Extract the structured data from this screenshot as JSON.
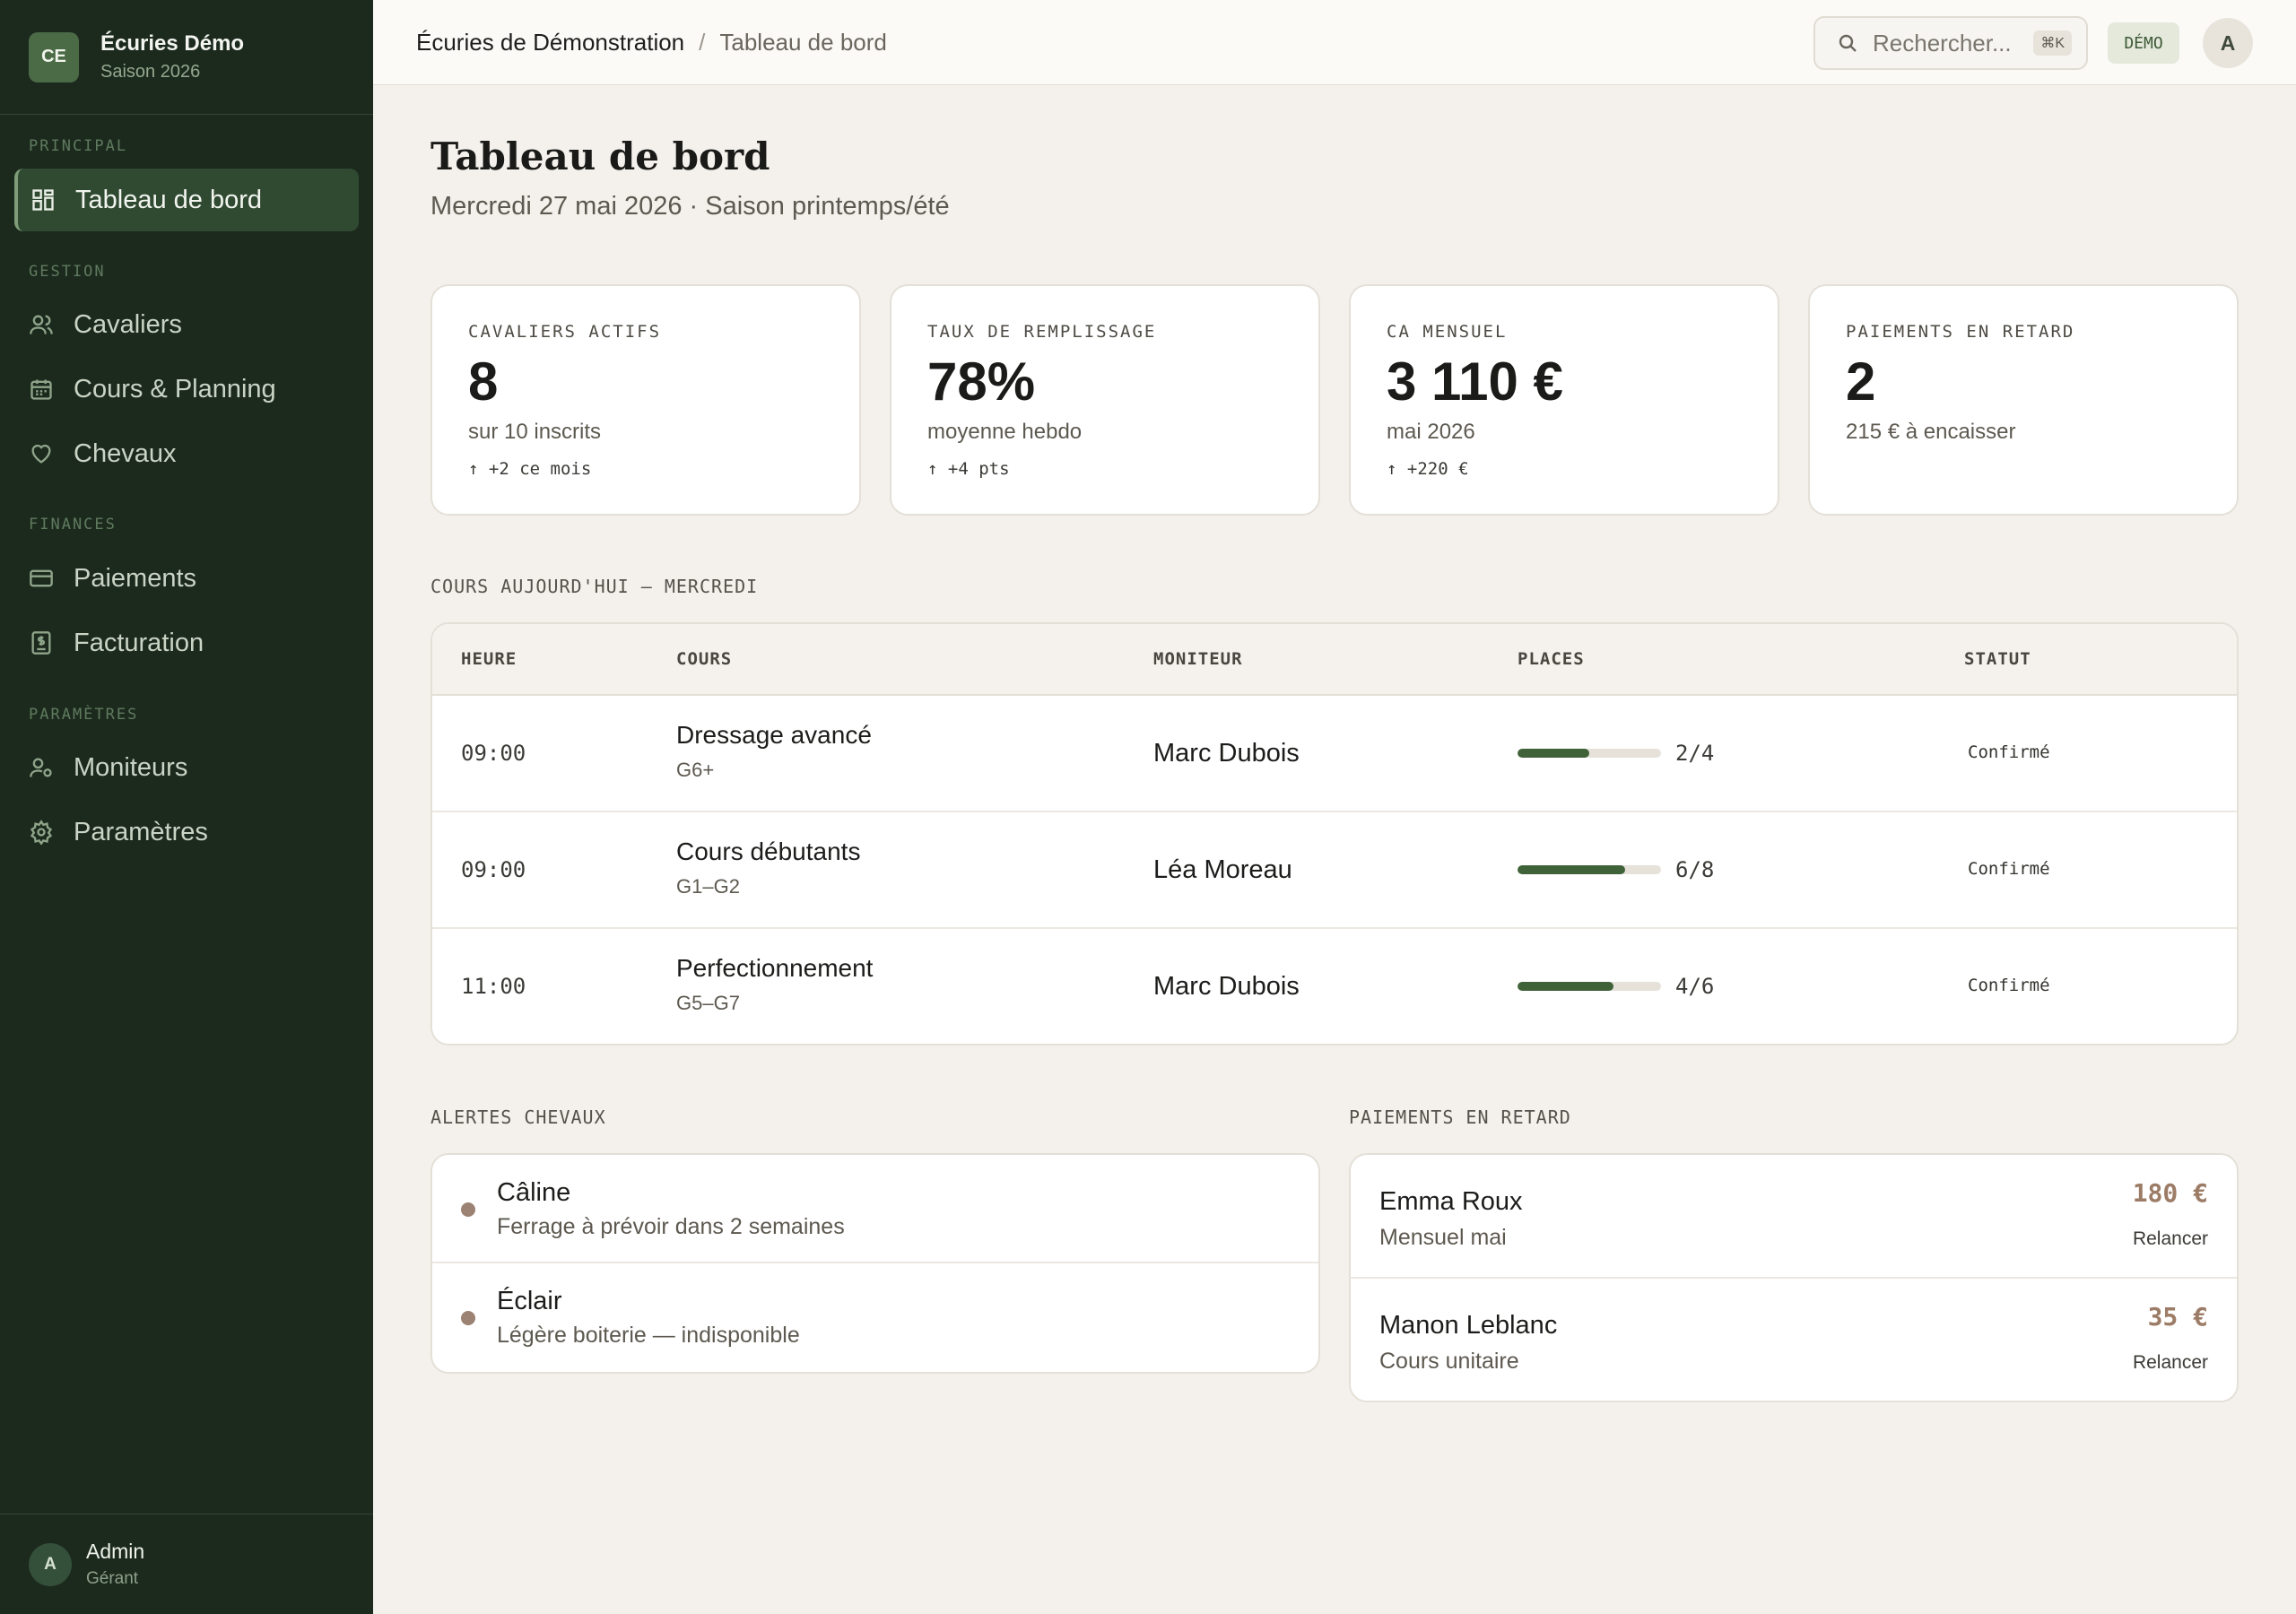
{
  "sidebar": {
    "brand": {
      "initials": "CE",
      "name": "Écuries Démo",
      "subtitle": "Saison 2026"
    },
    "sections": {
      "principal": "PRINCIPAL",
      "gestion": "GESTION",
      "finances": "FINANCES",
      "parametres": "PARAMÈTRES"
    },
    "items": {
      "dashboard": "Tableau de bord",
      "riders": "Cavaliers",
      "lessons": "Cours & Planning",
      "horses": "Chevaux",
      "payments": "Paiements",
      "billing": "Facturation",
      "instructors": "Moniteurs",
      "settings": "Paramètres"
    },
    "user": {
      "initial": "A",
      "name": "Admin",
      "role": "Gérant"
    }
  },
  "topbar": {
    "breadcrumb_root": "Écuries de Démonstration",
    "breadcrumb_sep": "/",
    "breadcrumb_current": "Tableau de bord",
    "search_placeholder": "Rechercher...",
    "search_shortcut": "⌘K",
    "badge": "DÉMO",
    "avatar_initial": "A"
  },
  "page": {
    "title": "Tableau de bord",
    "subtitle": "Mercredi 27 mai 2026 · Saison printemps/été"
  },
  "kpis": [
    {
      "label": "CAVALIERS ACTIFS",
      "value": "8",
      "caption": "sur 10 inscrits",
      "trend": "↑ +2 ce mois"
    },
    {
      "label": "TAUX DE REMPLISSAGE",
      "value": "78%",
      "caption": "moyenne hebdo",
      "trend": "↑ +4 pts"
    },
    {
      "label": "CA MENSUEL",
      "value": "3 110 €",
      "caption": "mai 2026",
      "trend": "↑ +220 €"
    },
    {
      "label": "PAIEMENTS EN RETARD",
      "value": "2",
      "caption": "215 € à encaisser",
      "trend": ""
    }
  ],
  "lessons": {
    "section_title": "COURS AUJOURD'HUI — MERCREDI",
    "headers": {
      "time": "HEURE",
      "course": "COURS",
      "instructor": "MONITEUR",
      "places": "PLACES",
      "status": "STATUT"
    },
    "rows": [
      {
        "time": "09:00",
        "course": "Dressage avancé",
        "level": "G6+",
        "instructor": "Marc Dubois",
        "places": "2/4",
        "fill": 0.5,
        "status": "Confirmé"
      },
      {
        "time": "09:00",
        "course": "Cours débutants",
        "level": "G1–G2",
        "instructor": "Léa Moreau",
        "places": "6/8",
        "fill": 0.75,
        "status": "Confirmé"
      },
      {
        "time": "11:00",
        "course": "Perfectionnement",
        "level": "G5–G7",
        "instructor": "Marc Dubois",
        "places": "4/6",
        "fill": 0.667,
        "status": "Confirmé"
      }
    ]
  },
  "horse_alerts": {
    "section_title": "ALERTES CHEVAUX",
    "items": [
      {
        "name": "Câline",
        "description": "Ferrage à prévoir dans 2 semaines"
      },
      {
        "name": "Éclair",
        "description": "Légère boiterie — indisponible"
      }
    ]
  },
  "late_payments": {
    "section_title": "PAIEMENTS EN RETARD",
    "items": [
      {
        "name": "Emma Roux",
        "description": "Mensuel mai",
        "amount": "180 €",
        "action": "Relancer"
      },
      {
        "name": "Manon Leblanc",
        "description": "Cours unitaire",
        "amount": "35 €",
        "action": "Relancer"
      }
    ]
  },
  "colors": {
    "sidebar_bg": "#1c2a1e",
    "accent": "#3f6239",
    "amount": "#9c7c66",
    "page_bg": "#f4f1ec"
  }
}
